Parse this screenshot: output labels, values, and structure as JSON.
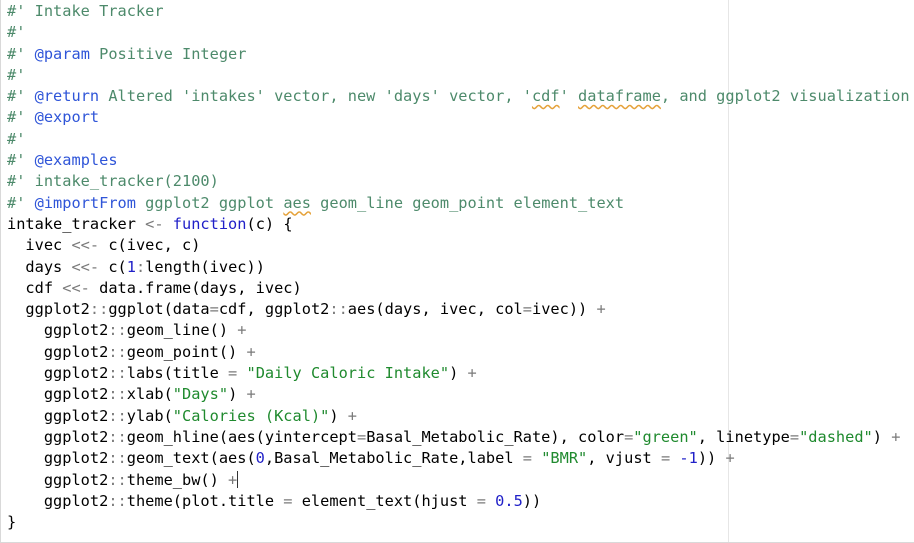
{
  "editor": {
    "language": "R",
    "colors": {
      "comment": "#4d8a6b",
      "roxygen_tag": "#2f55d8",
      "string": "#1f8a2e",
      "keyword": "#2020c8",
      "number": "#2020c8",
      "operator": "#7a7a7a",
      "spellcheck_underline": "#e5a23a"
    },
    "lines": [
      [
        "#' Intake Tracker"
      ],
      [
        "#'"
      ],
      [
        "#' ",
        "@param",
        " Positive Integer"
      ],
      [
        "#'"
      ],
      [
        "#' ",
        "@return",
        " Altered 'intakes' vector, new 'days' vector, '",
        "cdf",
        "' ",
        "dataframe",
        ", and ggplot2 visualization"
      ],
      [
        "#' ",
        "@export"
      ],
      [
        "#'"
      ],
      [
        "#' ",
        "@examples"
      ],
      [
        "#' intake_tracker(2100)"
      ],
      [
        "#' ",
        "@importFrom",
        " ggplot2 ggplot ",
        "aes",
        " geom_line geom_point element_text"
      ],
      [
        "intake_tracker ",
        "<-",
        " ",
        "function",
        "(c) {"
      ],
      [
        "  ivec ",
        "<<-",
        " c(ivec, c)"
      ],
      [
        "  days ",
        "<<-",
        " c(",
        "1",
        ":",
        "length(ivec))"
      ],
      [
        "  cdf ",
        "<<-",
        " data.frame(days, ivec)"
      ],
      [
        "  ggplot2",
        "::",
        "ggplot(data",
        "=",
        "cdf, ggplot2",
        "::",
        "aes(days, ivec, col",
        "=",
        "ivec)) ",
        "+"
      ],
      [
        "    ggplot2",
        "::",
        "geom_line() ",
        "+"
      ],
      [
        "    ggplot2",
        "::",
        "geom_point() ",
        "+"
      ],
      [
        "    ggplot2",
        "::",
        "labs(title ",
        "=",
        " ",
        "\"Daily Caloric Intake\"",
        ") ",
        "+"
      ],
      [
        "    ggplot2",
        "::",
        "xlab(",
        "\"Days\"",
        ") ",
        "+"
      ],
      [
        "    ggplot2",
        "::",
        "ylab(",
        "\"Calories (Kcal)\"",
        ") ",
        "+"
      ],
      [
        "    ggplot2",
        "::",
        "geom_hline(aes(yintercept",
        "=",
        "Basal_Metabolic_Rate), color",
        "=",
        "\"green\"",
        ", linetype",
        "=",
        "\"dashed\"",
        ") ",
        "+"
      ],
      [
        "    ggplot2",
        "::",
        "geom_text(aes(",
        "0",
        ",Basal_Metabolic_Rate,label ",
        "=",
        " ",
        "\"BMR\"",
        ", vjust ",
        "=",
        " ",
        "-1",
        ")) ",
        "+"
      ],
      [
        "    ggplot2",
        "::",
        "theme_bw() ",
        "+"
      ],
      [
        "    ggplot2",
        "::",
        "theme(plot.title ",
        "=",
        " element_text(hjust ",
        "=",
        " ",
        "0.5",
        "))"
      ],
      [
        "}"
      ]
    ]
  }
}
